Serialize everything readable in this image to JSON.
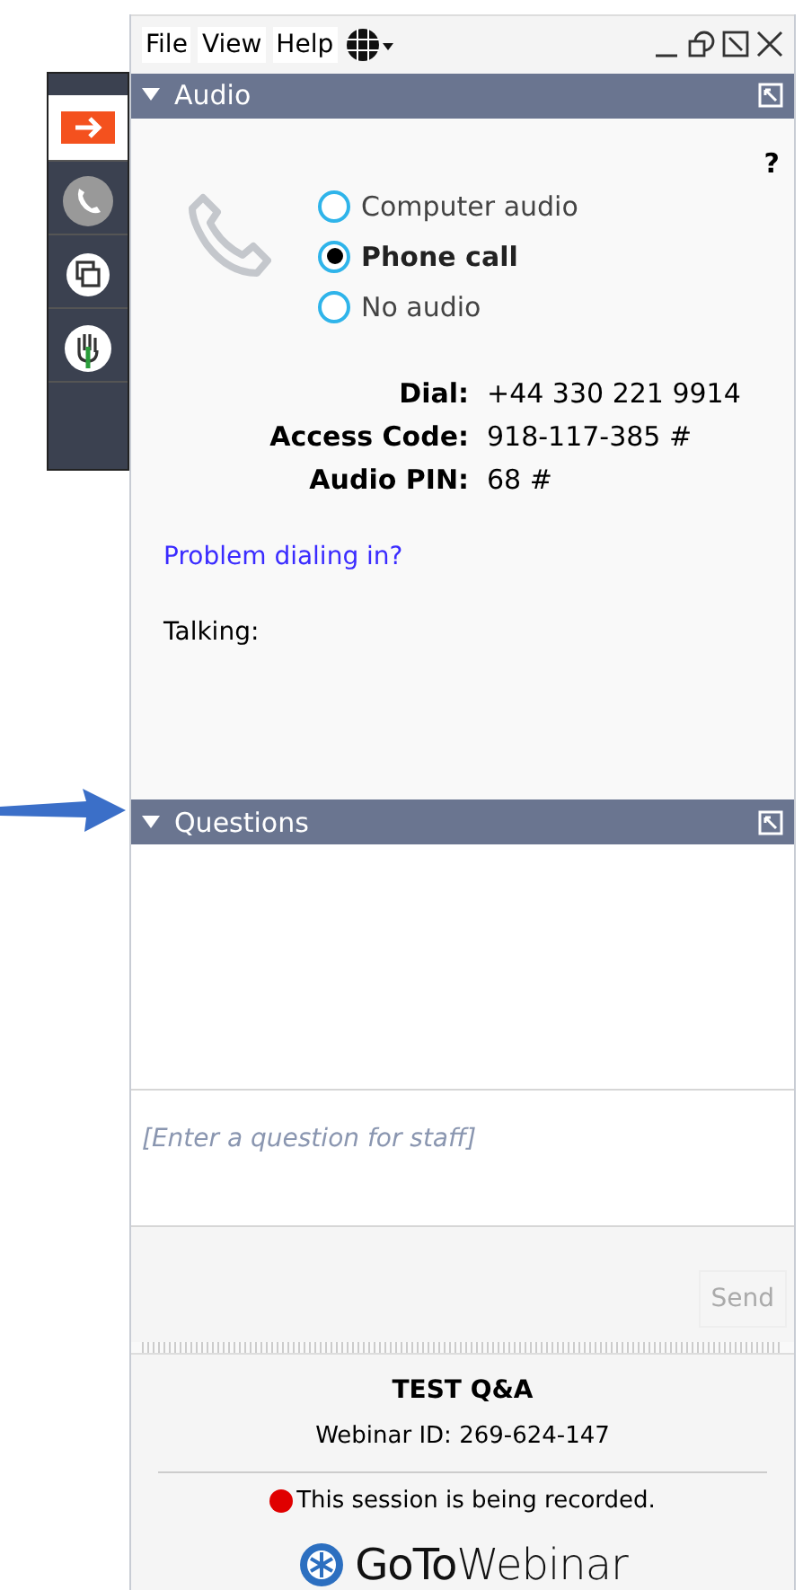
{
  "menu": [
    "File",
    "View",
    "Help"
  ],
  "audio": {
    "title": "Audio",
    "help": "?",
    "options": [
      {
        "label": "Computer audio",
        "selected": false
      },
      {
        "label": "Phone call",
        "selected": true
      },
      {
        "label": "No audio",
        "selected": false
      }
    ],
    "details": [
      {
        "label": "Dial:",
        "value": "+44 330 221 9914"
      },
      {
        "label": "Access Code:",
        "value": "918-117-385 #"
      },
      {
        "label": "Audio PIN:",
        "value": "68 #"
      }
    ],
    "link": "Problem dialing in?",
    "talking": "Talking:"
  },
  "questions": {
    "title": "Questions",
    "placeholder": "[Enter a question for staff]",
    "send": "Send"
  },
  "footer": {
    "title": "TEST Q&A",
    "webinar_id": "Webinar ID: 269-624-147",
    "recording": "This session is being recorded.",
    "logo": "**GoTo**Webinar"
  }
}
